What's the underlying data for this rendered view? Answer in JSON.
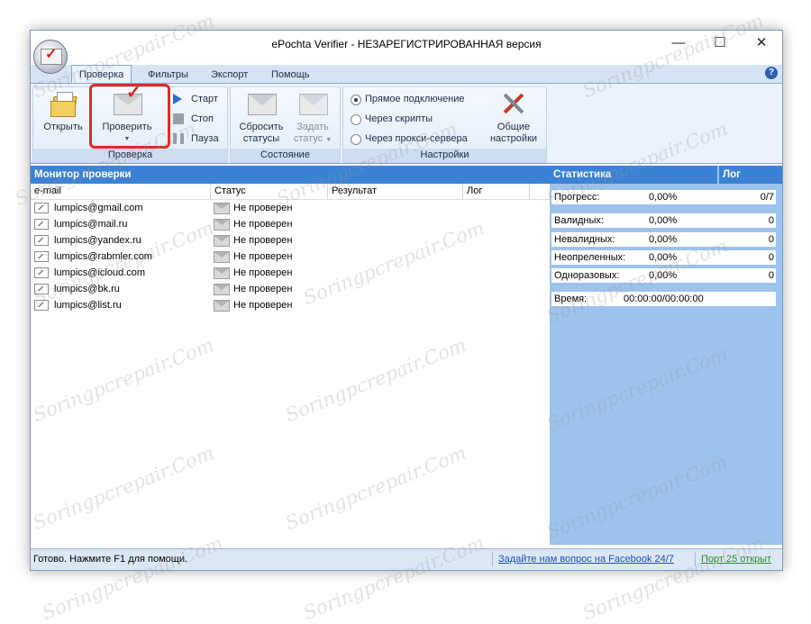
{
  "window": {
    "title": "ePochta Verifier - НЕЗАРЕГИСТРИРОВАННАЯ версия",
    "minimize_glyph": "—",
    "maximize_glyph": "☐",
    "close_glyph": "✕",
    "help_glyph": "?"
  },
  "tabs": [
    {
      "label": "Проверка",
      "active": true
    },
    {
      "label": "Фильтры",
      "active": false
    },
    {
      "label": "Экспорт",
      "active": false
    },
    {
      "label": "Помощь",
      "active": false
    }
  ],
  "ribbon": {
    "check_group": {
      "label": "Проверка",
      "open_label": "Открыть",
      "verify_label": "Проверить",
      "start_label": "Старт",
      "stop_label": "Стоп",
      "pause_label": "Пауза"
    },
    "state_group": {
      "label": "Состояние",
      "reset_line1": "Сбросить",
      "reset_line2": "статусы",
      "set_line1": "Задать",
      "set_line2": "статус"
    },
    "settings_group": {
      "label": "Настройки",
      "radio_direct": "Прямое подключение",
      "radio_scripts": "Через скрипты",
      "radio_proxy": "Через прокси-сервера",
      "general_line1": "Общие",
      "general_line2": "настройки"
    }
  },
  "monitor": {
    "title": "Монитор проверки",
    "columns": [
      "e-mail",
      "Статус",
      "Результат",
      "Лог"
    ],
    "rows": [
      {
        "email": "lumpics@gmail.com",
        "status": "Не проверен"
      },
      {
        "email": "lumpics@mail.ru",
        "status": "Не проверен"
      },
      {
        "email": "lumpics@yandex.ru",
        "status": "Не проверен"
      },
      {
        "email": "lumpics@rabmler.com",
        "status": "Не проверен"
      },
      {
        "email": "lumpics@icloud.com",
        "status": "Не проверен"
      },
      {
        "email": "lumpics@bk.ru",
        "status": "Не проверен"
      },
      {
        "email": "lumpics@list.ru",
        "status": "Не проверен"
      }
    ]
  },
  "stats": {
    "title": "Статистика",
    "log_title": "Лог",
    "progress": {
      "label": "Прогресс:",
      "percent": "0,00%",
      "count": "0/7"
    },
    "valid": {
      "label": "Валидных:",
      "percent": "0,00%",
      "count": "0"
    },
    "invalid": {
      "label": "Невалидных:",
      "percent": "0,00%",
      "count": "0"
    },
    "undefined": {
      "label": "Неопреленных:",
      "percent": "0,00%",
      "count": "0"
    },
    "disposable": {
      "label": "Одноразовых:",
      "percent": "0,00%",
      "count": "0"
    },
    "time": {
      "label": "Время:",
      "value": "00:00:00/00:00:00"
    }
  },
  "statusbar": {
    "text": "Готово. Нажмите F1 для помощи.",
    "facebook_link": "Задайте нам вопрос на Facebook 24/7",
    "port": "Порт 25 открыт"
  },
  "watermark": "Soringpcrepair.Com",
  "colors": {
    "panel_header": "#3b82d4",
    "stats_background": "#9dc3ec",
    "highlight": "#e02a2a",
    "port_text": "#2d8a2d",
    "link_text": "#1f4eb5"
  }
}
